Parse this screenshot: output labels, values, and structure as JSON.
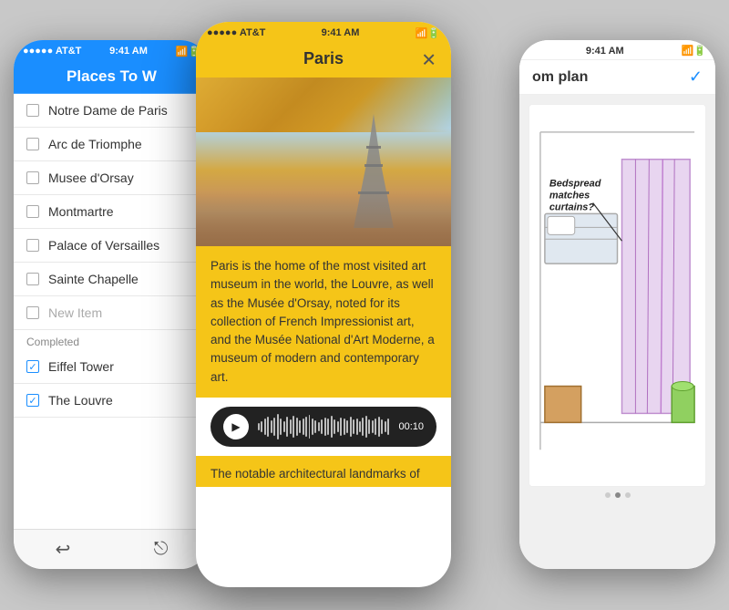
{
  "left_phone": {
    "status_bar": {
      "carrier": "●●●●● AT&T",
      "time": "9:41 AM",
      "wifi": "wifi",
      "battery": "battery"
    },
    "header": "Places To W",
    "list_items": [
      {
        "label": "Notre Dame de Paris",
        "checked": false
      },
      {
        "label": "Arc de Triomphe",
        "checked": false
      },
      {
        "label": "Musee d'Orsay",
        "checked": false
      },
      {
        "label": "Montmartre",
        "checked": false
      },
      {
        "label": "Palace of Versailles",
        "checked": false
      },
      {
        "label": "Sainte Chapelle",
        "checked": false
      }
    ],
    "new_item_label": "New Item",
    "section_completed": "Completed",
    "completed_items": [
      {
        "label": "Eiffel Tower",
        "checked": true
      },
      {
        "label": "The Louvre",
        "checked": true
      }
    ]
  },
  "middle_phone": {
    "status_bar": {
      "carrier": "●●●●● AT&T",
      "time": "9:41 AM"
    },
    "title": "Paris",
    "description": "Paris is the home of the most visited art museum in the world, the Louvre, as well as the Musée d'Orsay, noted for its collection of French Impressionist art, and the Musée National d'Art Moderne, a museum of modern and contemporary art.",
    "audio_time": "00:10",
    "bottom_text": "The notable architectural landmarks of"
  },
  "right_phone": {
    "status_bar": {
      "time": "9:41 AM"
    },
    "header_title": "om plan",
    "checkmark": "✓",
    "sketch_text": "Bedspread matches curtains?",
    "dot_count": 3,
    "active_dot": 1
  },
  "colors": {
    "ios_blue": "#1a8eff",
    "paris_yellow": "#f5c518",
    "dark": "#222222"
  }
}
